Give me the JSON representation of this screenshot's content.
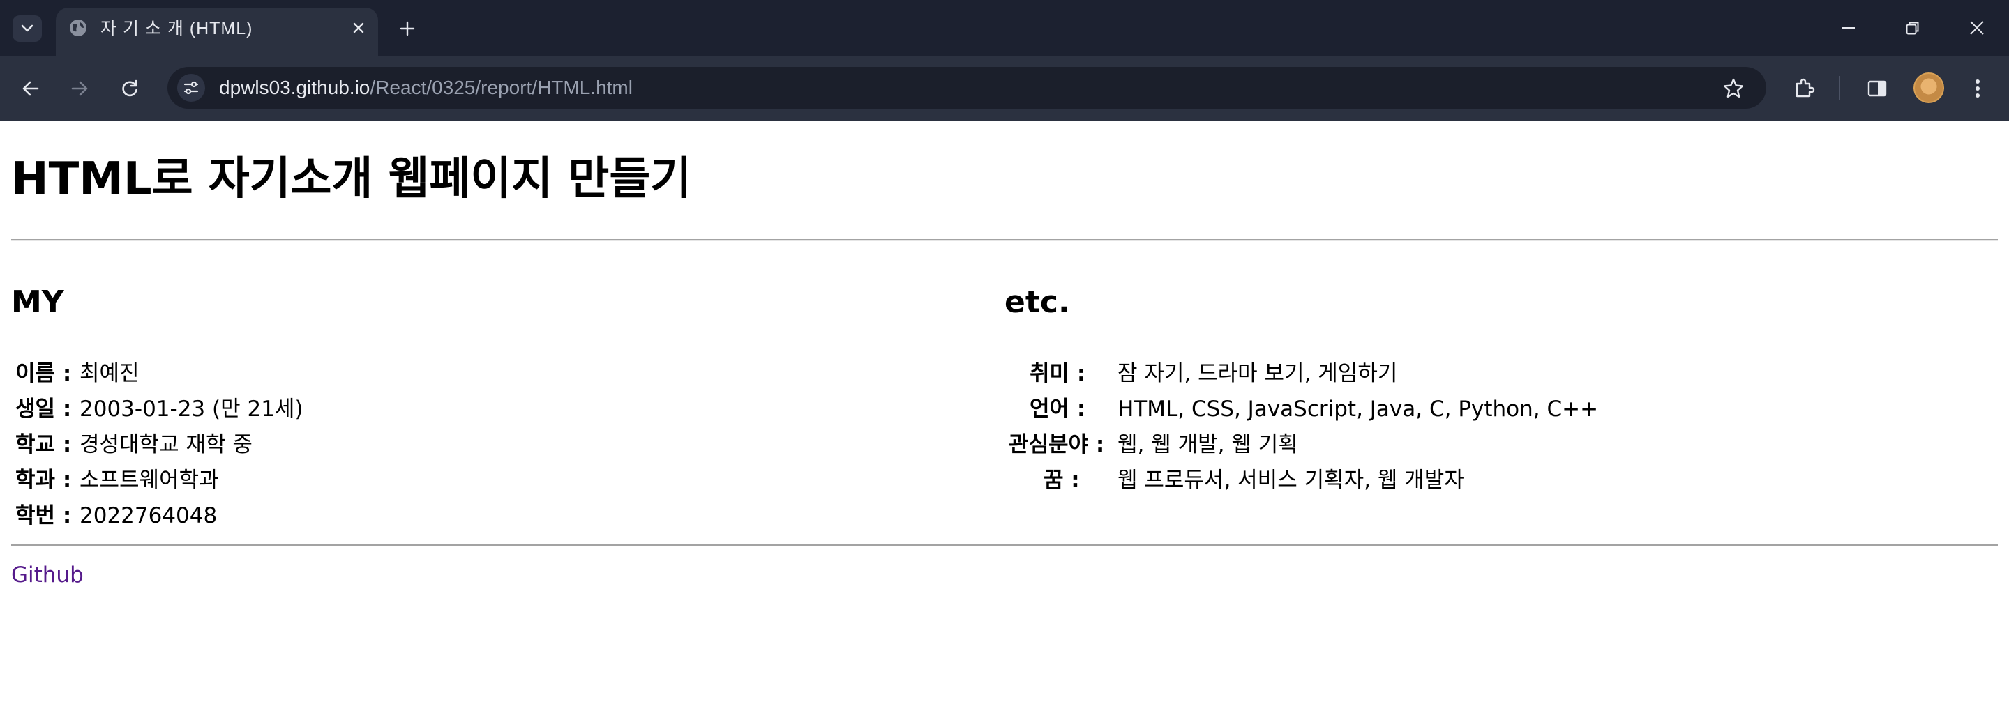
{
  "browser": {
    "tab_title": "자 기 소 개 (HTML)",
    "url_host": "dpwls03.github.io",
    "url_path": "/React/0325/report/HTML.html",
    "icons": [
      "tab-search-icon",
      "globe-icon",
      "close-icon",
      "plus-icon",
      "minimize-icon",
      "restore-icon",
      "close-window-icon",
      "back-icon",
      "forward-icon",
      "reload-icon",
      "site-info-icon",
      "star-icon",
      "extensions-icon",
      "side-panel-icon",
      "avatar",
      "menu-icon"
    ],
    "colors": {
      "tabbar": "#1c2130",
      "toolbar": "#2b3140",
      "omnibox": "#1b1f2b"
    }
  },
  "page": {
    "title": "HTML로 자기소개 웹페이지 만들기",
    "my": {
      "heading": "MY",
      "rows": [
        {
          "label": "이름 :",
          "value": "최예진"
        },
        {
          "label": "생일 :",
          "value": "2003-01-23 (만 21세)"
        },
        {
          "label": "학교 :",
          "value": "경성대학교 재학 중"
        },
        {
          "label": "학과 :",
          "value": "소프트웨어학과"
        },
        {
          "label": "학번 :",
          "value": "2022764048"
        }
      ]
    },
    "etc": {
      "heading": "etc.",
      "rows": [
        {
          "label": "취미 :",
          "value": "잠 자기, 드라마 보기, 게임하기"
        },
        {
          "label": "언어 :",
          "value": "HTML, CSS, JavaScript, Java, C, Python, C++"
        },
        {
          "label": "관심분야 :",
          "value": "웹, 웹 개발, 웹 기획"
        },
        {
          "label": "꿈 :",
          "value": "웹 프로듀서, 서비스 기획자, 웹 개발자"
        }
      ]
    },
    "link_label": "Github",
    "colors": {
      "link": "#551a8b",
      "rule": "#a3a3a3"
    }
  }
}
